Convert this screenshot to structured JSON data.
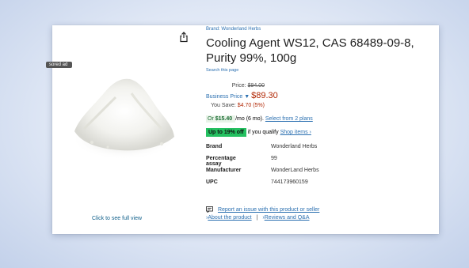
{
  "sponsored": "sored ad",
  "image": {
    "full_view": "Click to see full view"
  },
  "product": {
    "brand_link": "Brand: Wonderland Herbs",
    "title": "Cooling Agent WS12, CAS 68489-09-8, Purity 99%, 100g",
    "search_link": "Search this page"
  },
  "pricing": {
    "price_label": "Price:",
    "list_price": "$94.00",
    "business_label": "Business Price",
    "business_price": "$89.30",
    "save_label": "You Save:",
    "save_value": "$4.70 (5%)"
  },
  "plans": {
    "prefix": "Or",
    "amount": "$15.40",
    "suffix": "/mo (6 mo).",
    "link": "Select from 2 plans"
  },
  "offer": {
    "badge": "Up to 19% off",
    "text": "if you qualify",
    "link": "Shop items ›"
  },
  "specs": [
    {
      "k": "Brand",
      "v": "Wonderland Herbs"
    },
    {
      "k": "Percentage assay",
      "v": "99"
    },
    {
      "k": "Manufacturer",
      "v": "WonderLand Herbs"
    },
    {
      "k": "UPC",
      "v": "744173960159"
    }
  ],
  "report": "Report an issue with this product or seller",
  "links": {
    "about": "About the product",
    "sep": "|",
    "reviews": "Reviews and Q&A"
  },
  "colors": {
    "link": "#2a6fb0",
    "price_red": "#b12704",
    "badge_green": "#24c060"
  }
}
